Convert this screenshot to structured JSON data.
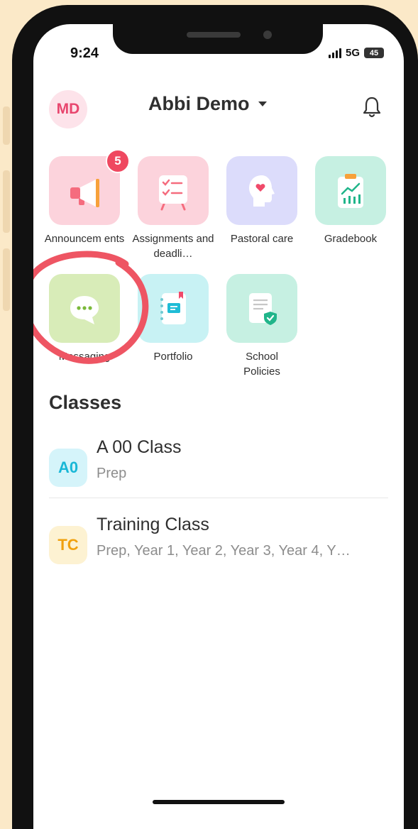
{
  "status_bar": {
    "time": "9:24",
    "network": "5G",
    "battery": "45"
  },
  "header": {
    "avatar_initials": "MD",
    "profile_name": "Abbi Demo"
  },
  "tiles": [
    {
      "label": "Announcem ents",
      "badge": "5"
    },
    {
      "label": "Assignments and deadli…"
    },
    {
      "label": "Pastoral care"
    },
    {
      "label": "Gradebook"
    },
    {
      "label": "Messaging"
    },
    {
      "label": "Portfolio"
    },
    {
      "label": "School Policies"
    }
  ],
  "classes": {
    "title": "Classes",
    "items": [
      {
        "initials": "A0",
        "name": "A 00 Class",
        "years": "Prep"
      },
      {
        "initials": "TC",
        "name": "Training Class",
        "years": "Prep, Year 1, Year 2, Year 3, Year 4, Y…"
      }
    ]
  },
  "colors": {
    "accent_pink": "#e8466e",
    "badge_red": "#ef4860",
    "highlight_ring": "#ee5563",
    "class_a0": "#19b7d6",
    "class_tc": "#f0a10f"
  },
  "icons": [
    "megaphone-icon",
    "checklist-board-icon",
    "heart-head-icon",
    "chart-clipboard-icon",
    "chat-bubble-icon",
    "notebook-icon",
    "shield-document-icon",
    "bell-icon",
    "chevron-down-icon"
  ]
}
